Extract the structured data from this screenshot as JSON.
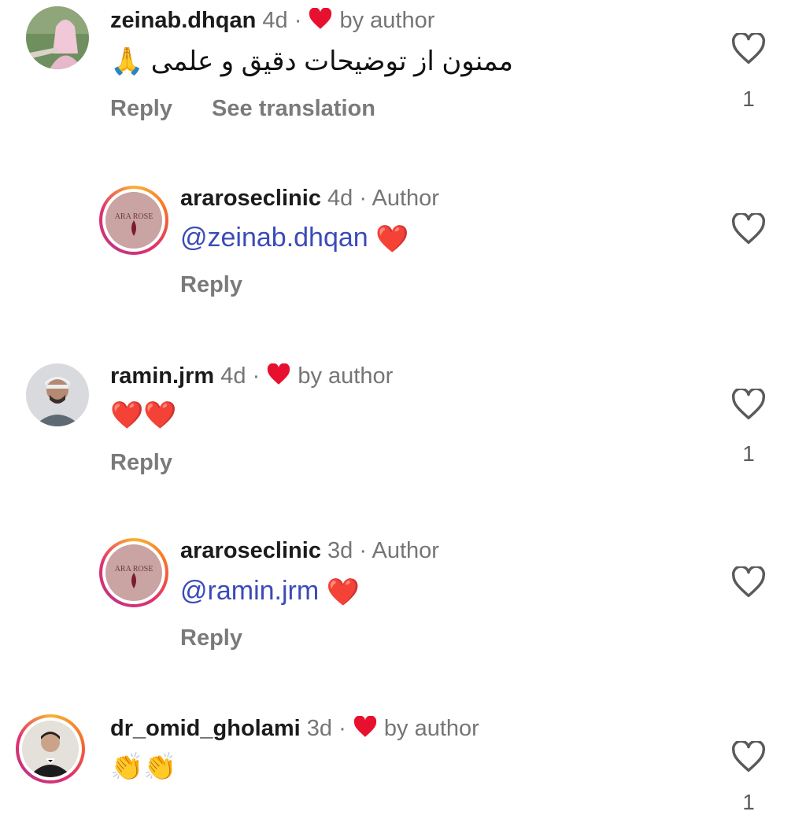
{
  "comments": [
    {
      "username": "zeinab.dhqan",
      "time": "4d",
      "badge": "by author",
      "text": "ممنون از  توضیحات دقیق و علمی 🙏",
      "actions": [
        "Reply",
        "See translation"
      ],
      "likes": "1"
    },
    {
      "username": "araroseclinic",
      "time": "4d",
      "badge": "Author",
      "mention": "@zeinab.dhqan",
      "text": "❤️",
      "actions": [
        "Reply"
      ],
      "likes": ""
    },
    {
      "username": "ramin.jrm",
      "time": "4d",
      "badge": "by author",
      "text": "❤️❤️",
      "actions": [
        "Reply"
      ],
      "likes": "1"
    },
    {
      "username": "araroseclinic",
      "time": "3d",
      "badge": "Author",
      "mention": "@ramin.jrm",
      "text": "❤️",
      "actions": [
        "Reply"
      ],
      "likes": ""
    },
    {
      "username": "dr_omid_gholami",
      "time": "3d",
      "badge": "by author",
      "text": "👏👏",
      "actions": [],
      "likes": "1"
    }
  ],
  "separator": "·",
  "clinic_logo_text": "ARA ROSE",
  "colors": {
    "heart_red": "#e8102f",
    "mention_blue": "#3b4bb8",
    "muted": "#757575"
  },
  "icons": [
    "heart-outline-icon",
    "heart-filled-icon"
  ]
}
